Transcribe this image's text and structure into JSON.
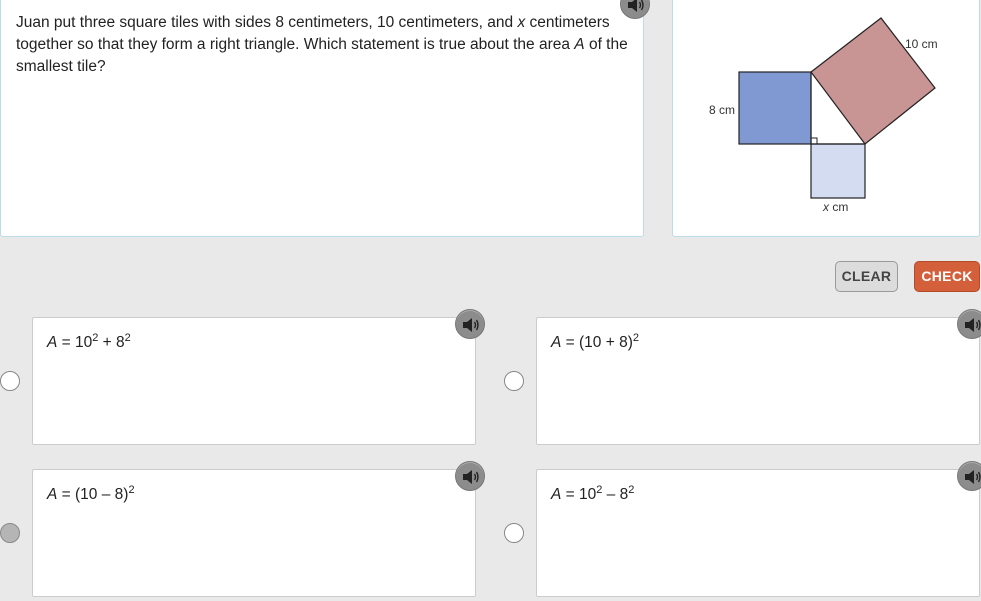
{
  "question": {
    "text_part1": "Juan put three square tiles with sides 8 centimeters, 10 centimeters, and ",
    "var_x": "x",
    "text_part2": " centimeters together so that they form a right triangle. Which statement is true about the area ",
    "var_a": "A",
    "text_part3": " of the smallest tile?"
  },
  "figure": {
    "label_8": "8 cm",
    "label_10": "10 cm",
    "label_x_var": "x",
    "label_x_unit": " cm",
    "colors": {
      "square_8": "#8099d3",
      "square_10": "#c99494",
      "square_x": "#d3dcf0"
    }
  },
  "buttons": {
    "clear_label": "CLEAR",
    "check_label": "CHECK"
  },
  "choices": [
    {
      "var": "A",
      "pre": " = 10",
      "sup1": "2",
      "mid": " + 8",
      "sup2": "2",
      "selected": false
    },
    {
      "var": "A",
      "pre": " = (10 + 8)",
      "sup1": "2",
      "mid": "",
      "sup2": "",
      "selected": false
    },
    {
      "var": "A",
      "pre": " = (10 – 8)",
      "sup1": "2",
      "mid": "",
      "sup2": "",
      "selected": true
    },
    {
      "var": "A",
      "pre": " = 10",
      "sup1": "2",
      "mid": " – 8",
      "sup2": "2",
      "selected": false
    }
  ],
  "icons": {
    "audio": "speaker-icon"
  }
}
